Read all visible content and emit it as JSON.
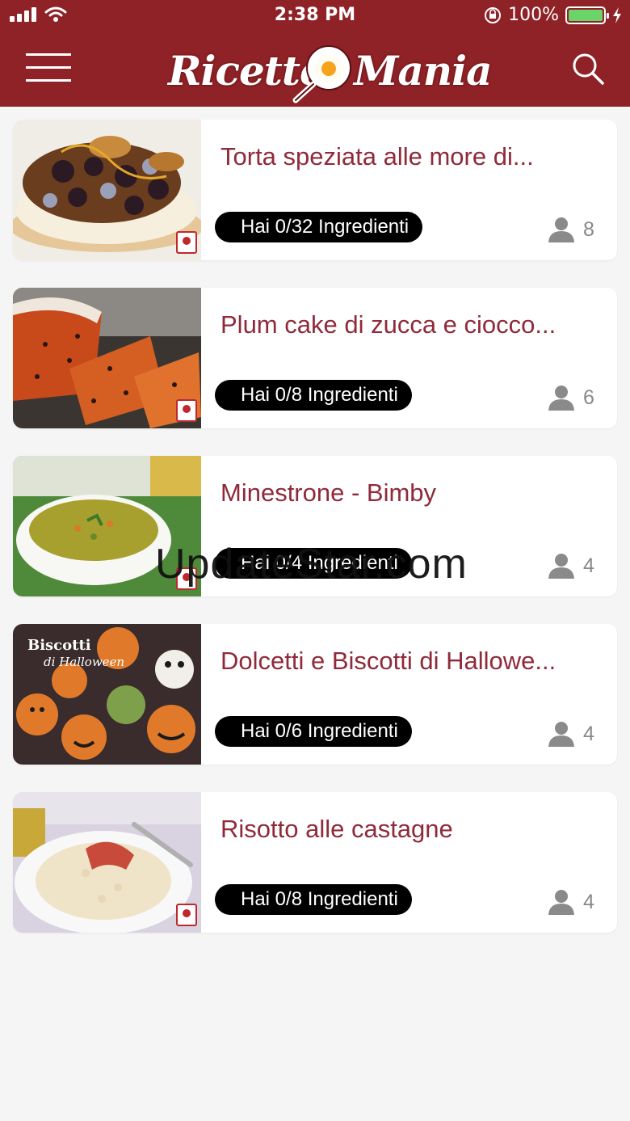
{
  "status_bar": {
    "time": "2:38 PM",
    "battery": "100%"
  },
  "header": {
    "logo_left": "Ricette",
    "logo_right": "Mania"
  },
  "recipes": [
    {
      "title": "Torta speziata alle more di...",
      "ingredients": "Hai 0/32 Ingredienti",
      "servings": "8"
    },
    {
      "title": "Plum cake di zucca e ciocco...",
      "ingredients": "Hai 0/8 Ingredienti",
      "servings": "6"
    },
    {
      "title": "Minestrone - Bimby",
      "ingredients": "Hai 0/4 Ingredienti",
      "servings": "4"
    },
    {
      "title": "Dolcetti e Biscotti di Hallowe...",
      "ingredients": "Hai 0/6 Ingredienti",
      "servings": "4",
      "thumb_caption_1": "Biscotti",
      "thumb_caption_2": "di Halloween"
    },
    {
      "title": "Risotto alle castagne",
      "ingredients": "Hai 0/8 Ingredienti",
      "servings": "4"
    }
  ],
  "watermark": "UpdateStar.com",
  "colors": {
    "brand": "#8f2226",
    "title": "#8f2a3a",
    "badge": "#000000"
  },
  "icons": [
    "hamburger-menu-icon",
    "search-icon",
    "person-icon",
    "wifi-icon",
    "battery-icon"
  ]
}
